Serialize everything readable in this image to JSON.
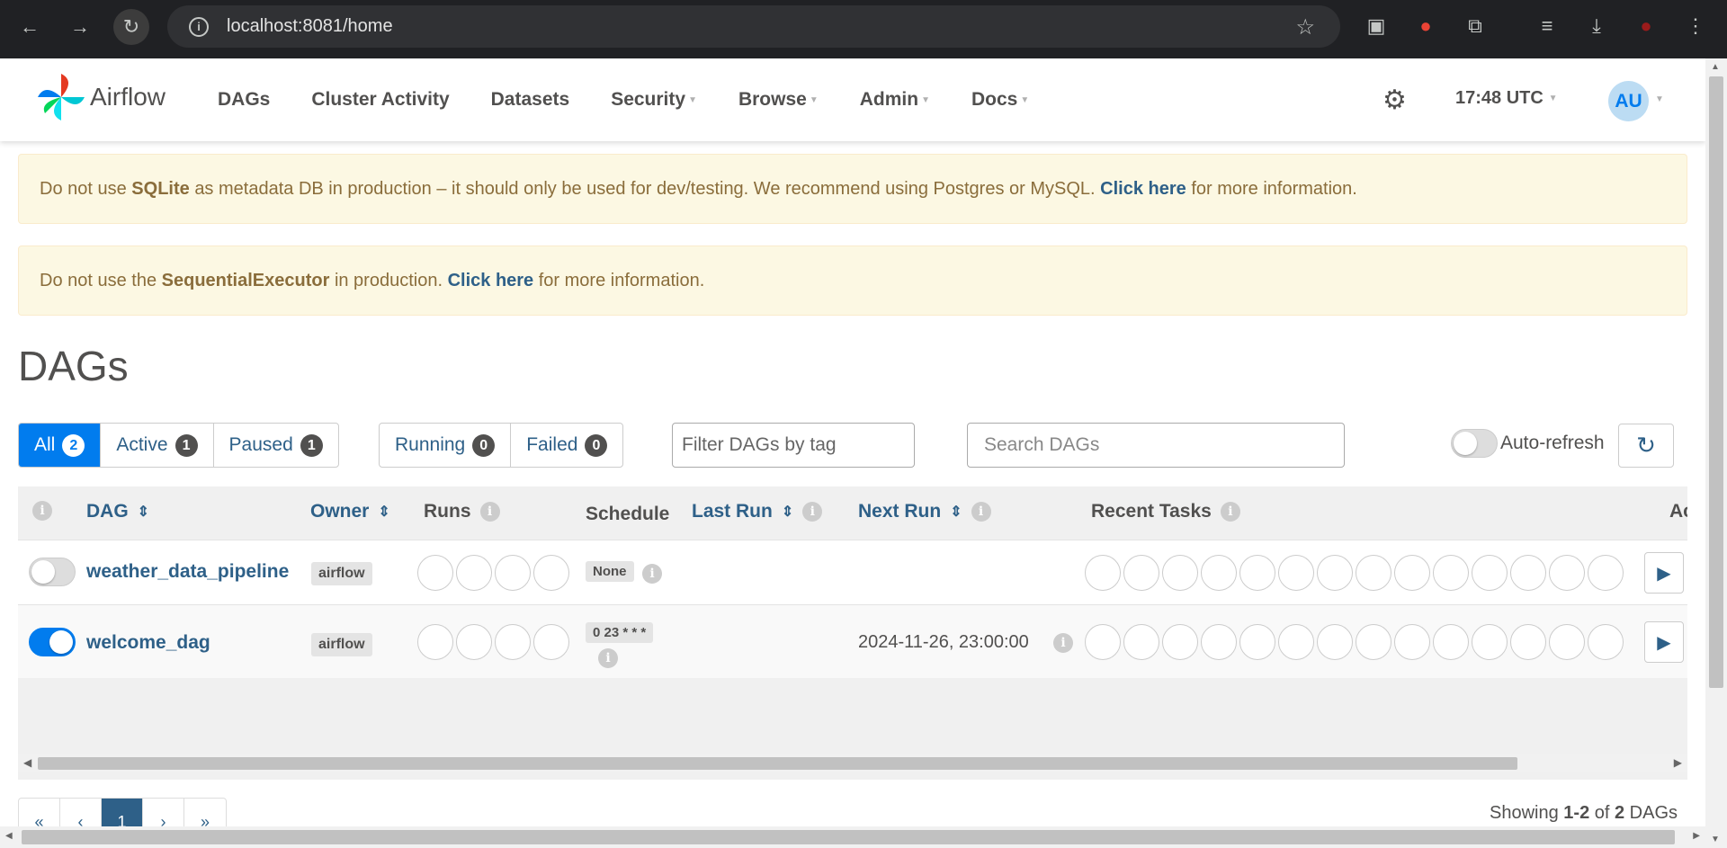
{
  "browser": {
    "url": "localhost:8081/home",
    "back_icon": "arrow-left-icon",
    "forward_icon": "arrow-right-icon",
    "reload_icon": "reload-icon"
  },
  "navbar": {
    "brand": "Airflow",
    "items": [
      {
        "label": "DAGs",
        "dropdown": false
      },
      {
        "label": "Cluster Activity",
        "dropdown": false
      },
      {
        "label": "Datasets",
        "dropdown": false
      },
      {
        "label": "Security",
        "dropdown": true
      },
      {
        "label": "Browse",
        "dropdown": true
      },
      {
        "label": "Admin",
        "dropdown": true
      },
      {
        "label": "Docs",
        "dropdown": true
      }
    ],
    "time": "17:48 UTC",
    "user_initials": "AU"
  },
  "alerts": {
    "sqlite": {
      "pre": "Do not use ",
      "strong": "SQLite",
      "mid": " as metadata DB in production – it should only be used for dev/testing. We recommend using Postgres or MySQL. ",
      "link": "Click here",
      "post": " for more information."
    },
    "executor": {
      "pre": "Do not use the ",
      "strong": "SequentialExecutor",
      "mid": " in production. ",
      "link": "Click here",
      "post": " for more information."
    }
  },
  "page": {
    "title": "DAGs"
  },
  "filters": {
    "status": [
      {
        "label": "All",
        "count": "2"
      },
      {
        "label": "Active",
        "count": "1"
      },
      {
        "label": "Paused",
        "count": "1"
      }
    ],
    "state": [
      {
        "label": "Running",
        "count": "0"
      },
      {
        "label": "Failed",
        "count": "0"
      }
    ],
    "tag_placeholder": "Filter DAGs by tag",
    "search_placeholder": "Search DAGs",
    "auto_refresh_label": "Auto-refresh"
  },
  "table": {
    "columns": {
      "dag": "DAG",
      "owner": "Owner",
      "runs": "Runs",
      "schedule": "Schedule",
      "last_run": "Last Run",
      "next_run": "Next Run",
      "recent_tasks": "Recent Tasks",
      "actions": "Ac"
    },
    "rows": [
      {
        "dag_id": "weather_data_pipeline",
        "owner": "airflow",
        "schedule": "None",
        "next_run": "",
        "active": false
      },
      {
        "dag_id": "welcome_dag",
        "owner": "airflow",
        "schedule": "0 23 * * *",
        "next_run": "2024-11-26, 23:00:00",
        "active": true
      }
    ]
  },
  "pagination": {
    "first": "«",
    "prev": "‹",
    "current": "1",
    "next": "›",
    "last": "»",
    "showing_pre": "Showing ",
    "showing_range": "1-2",
    "showing_mid": " of ",
    "showing_total": "2",
    "showing_post": " DAGs"
  }
}
